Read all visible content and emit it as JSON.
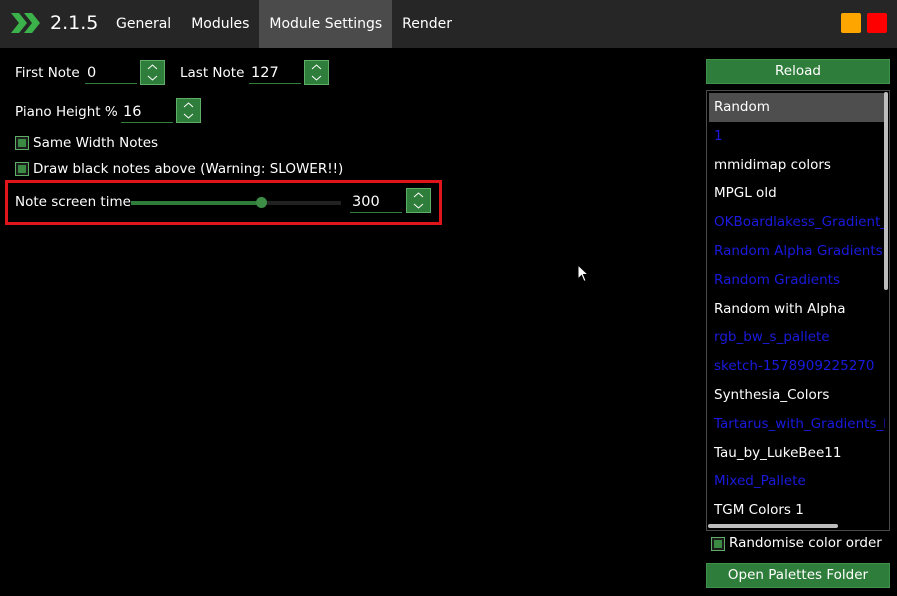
{
  "header": {
    "version": "2.1.5",
    "tabs": [
      {
        "label": "General"
      },
      {
        "label": "Modules"
      },
      {
        "label": "Module Settings"
      },
      {
        "label": "Render"
      }
    ],
    "active_tab": "Module Settings"
  },
  "settings": {
    "first_note": {
      "label": "First Note",
      "value": "0"
    },
    "last_note": {
      "label": "Last Note",
      "value": "127"
    },
    "piano_height": {
      "label": "Piano Height %",
      "value": "16"
    },
    "same_width_notes": {
      "label": "Same Width Notes",
      "checked": true
    },
    "draw_black_notes_above": {
      "label": "Draw black notes above (Warning: SLOWER!!)",
      "checked": true
    },
    "note_screen_time": {
      "label": "Note screen time",
      "value": "300",
      "slider_fraction": 0.62
    }
  },
  "palettes": {
    "reload_label": "Reload",
    "items": [
      {
        "label": "Random",
        "color": "#ffffff",
        "selected": true
      },
      {
        "label": "1",
        "color": "#1a1adf",
        "selected": false
      },
      {
        "label": "mmidimap colors",
        "color": "#ffffff",
        "selected": false
      },
      {
        "label": "MPGL old",
        "color": "#ffffff",
        "selected": false
      },
      {
        "label": "OKBoardlakess_Gradient_Pal",
        "color": "#1a1adf",
        "selected": false
      },
      {
        "label": "Random Alpha Gradients",
        "color": "#1a1adf",
        "selected": false
      },
      {
        "label": "Random Gradients",
        "color": "#1a1adf",
        "selected": false
      },
      {
        "label": "Random with Alpha",
        "color": "#ffffff",
        "selected": false
      },
      {
        "label": "rgb_bw_s_pallete",
        "color": "#1a1adf",
        "selected": false
      },
      {
        "label": "sketch-1578909225270",
        "color": "#1a1adf",
        "selected": false
      },
      {
        "label": "Synthesia_Colors",
        "color": "#ffffff",
        "selected": false
      },
      {
        "label": "Tartarus_with_Gradients_by_L",
        "color": "#1a1adf",
        "selected": false
      },
      {
        "label": "Tau_by_LukeBee11",
        "color": "#ffffff",
        "selected": false
      },
      {
        "label": "Mixed_Pallete",
        "color": "#1a1adf",
        "selected": false
      },
      {
        "label": "TGM Colors 1",
        "color": "#ffffff",
        "selected": false
      }
    ],
    "randomise": {
      "label": "Randomise color order",
      "checked": true
    },
    "open_folder_label": "Open Palettes Folder"
  },
  "colors": {
    "accent_green": "#2f7d3a",
    "highlight_red": "#e0141b",
    "minimize": "#ffa500",
    "close": "#ff0000"
  }
}
